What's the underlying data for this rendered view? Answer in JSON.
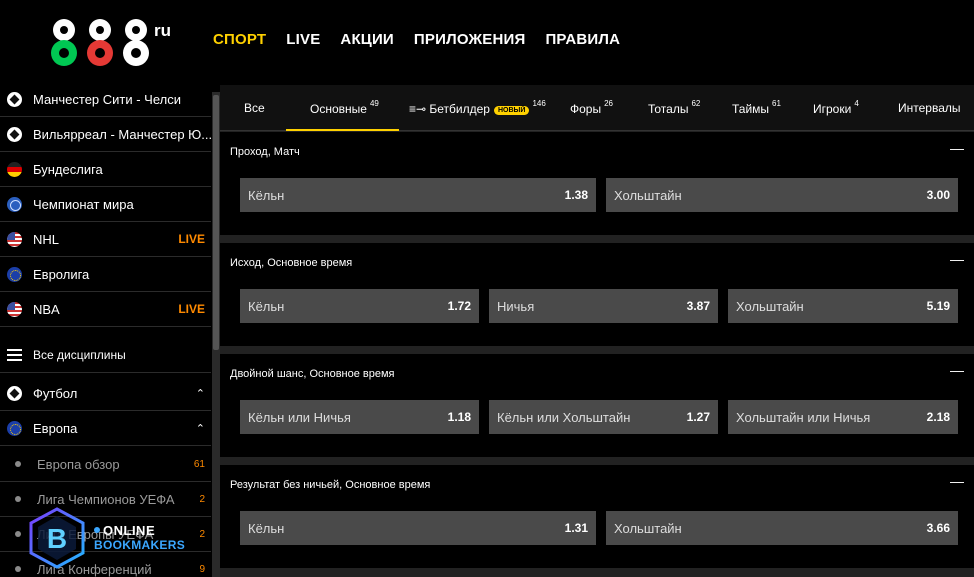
{
  "brand": {
    "logo_text": "888",
    "logo_suffix": "ru"
  },
  "nav": [
    "СПОРТ",
    "LIVE",
    "АКЦИИ",
    "ПРИЛОЖЕНИЯ",
    "ПРАВИЛА"
  ],
  "sidebar": {
    "favorites": [
      {
        "label": "Манчестер Сити - Челси",
        "icon": "soccer-ball-icon"
      },
      {
        "label": "Вильярреал - Манчестер Ю...",
        "icon": "soccer-ball-icon"
      },
      {
        "label": "Бундеслига",
        "icon": "germany-flag-icon"
      },
      {
        "label": "Чемпионат мира",
        "icon": "globe-icon"
      },
      {
        "label": "NHL",
        "icon": "usa-flag-icon",
        "live": "LIVE"
      },
      {
        "label": "Евролига",
        "icon": "eu-flag-icon"
      },
      {
        "label": "NBA",
        "icon": "usa-flag-icon",
        "live": "LIVE"
      }
    ],
    "all_disciplines": "Все дисциплины",
    "football": "Футбол",
    "europe": "Европа",
    "europe_sub": [
      {
        "label": "Европа обзор",
        "count": "61"
      },
      {
        "label": "Лига Чемпионов УЕФА",
        "count": "2"
      },
      {
        "label": "Лига Европы УЕФА",
        "count": "2"
      },
      {
        "label": "Лига Конференций",
        "count": "9"
      }
    ]
  },
  "tabs": [
    {
      "label": "Все",
      "count": ""
    },
    {
      "label": "Основные",
      "count": "49"
    },
    {
      "label": "Бетбилдер",
      "count": "146",
      "badge": "НОВЫЙ"
    },
    {
      "label": "Форы",
      "count": "26"
    },
    {
      "label": "Тоталы",
      "count": "62"
    },
    {
      "label": "Таймы",
      "count": "61"
    },
    {
      "label": "Игроки",
      "count": "4"
    },
    {
      "label": "Интервалы",
      "count": ""
    }
  ],
  "markets": [
    {
      "title": "Проход, Матч",
      "toggle": "—",
      "odds": [
        {
          "name": "Кёльн",
          "price": "1.38"
        },
        {
          "name": "Хольштайн",
          "price": "3.00"
        }
      ]
    },
    {
      "title": "Исход, Основное время",
      "toggle": "—",
      "odds": [
        {
          "name": "Кёльн",
          "price": "1.72"
        },
        {
          "name": "Ничья",
          "price": "3.87"
        },
        {
          "name": "Хольштайн",
          "price": "5.19"
        }
      ]
    },
    {
      "title": "Двойной шанс, Основное время",
      "toggle": "—",
      "odds": [
        {
          "name": "Кёльн или Ничья",
          "price": "1.18"
        },
        {
          "name": "Кёльн или Хольштайн",
          "price": "1.27"
        },
        {
          "name": "Хольштайн или Ничья",
          "price": "2.18"
        }
      ]
    },
    {
      "title": "Результат без ничьей, Основное время",
      "toggle": "—",
      "odds": [
        {
          "name": "Кёльн",
          "price": "1.31"
        },
        {
          "name": "Хольштайн",
          "price": "3.66"
        }
      ]
    }
  ],
  "watermark": {
    "line1": "ONLINE",
    "line2": "BOOKMAKERS",
    "letter": "B"
  },
  "colors": {
    "accent": "#ffd100",
    "live": "#ff8a00",
    "odd_bg": "#4a4a4a",
    "panel": "#000000",
    "gap": "#222222"
  }
}
